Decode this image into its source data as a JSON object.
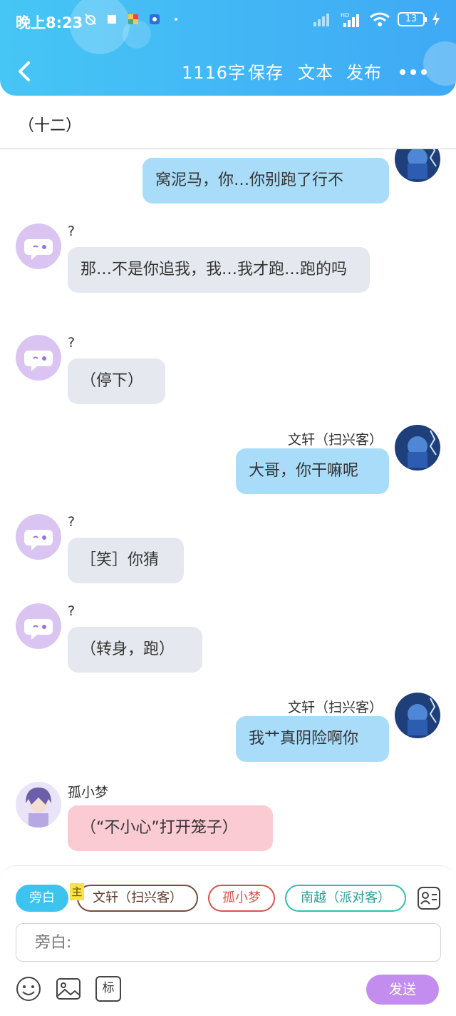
{
  "status_bar": {
    "time": "晚上8:23",
    "battery": "13"
  },
  "toolbar": {
    "word_count": "1116字",
    "save": "保存",
    "text": "文本",
    "publish": "发布"
  },
  "chapter": {
    "title": "（十二）"
  },
  "messages": [
    {
      "side": "right",
      "sender": "",
      "text": "窝泥马，你…你别跑了行不"
    },
    {
      "side": "left",
      "sender": "?",
      "text": "那…不是你追我，我…我才跑…跑的吗"
    },
    {
      "side": "left",
      "sender": "?",
      "text": "（停下）"
    },
    {
      "side": "right",
      "sender": "文轩（扫兴客）",
      "text": "大哥，你干嘛呢"
    },
    {
      "side": "left",
      "sender": "?",
      "text": "［笑］你猜"
    },
    {
      "side": "left",
      "sender": "?",
      "text": "（转身，跑）"
    },
    {
      "side": "right",
      "sender": "文轩（扫兴客）",
      "text": "我艹真阴险啊你"
    },
    {
      "side": "left",
      "sender": "孤小梦",
      "text": "（“不小心”打开笼子）"
    }
  ],
  "composer": {
    "roles": [
      "旁白",
      "文轩（扫兴客）",
      "孤小梦",
      "南越（派对客）"
    ],
    "host_badge": "主",
    "input_placeholder": "旁白:",
    "send": "发送",
    "tag_tool": "标"
  },
  "colors": {
    "header": "#3fa9f5",
    "bubble_self": "#a9dcf8",
    "bubble_other": "#e5e8ee",
    "bubble_pink": "#fbcbd4",
    "send_button": "#c38df0",
    "narrator_chip": "#3cc3ef"
  }
}
